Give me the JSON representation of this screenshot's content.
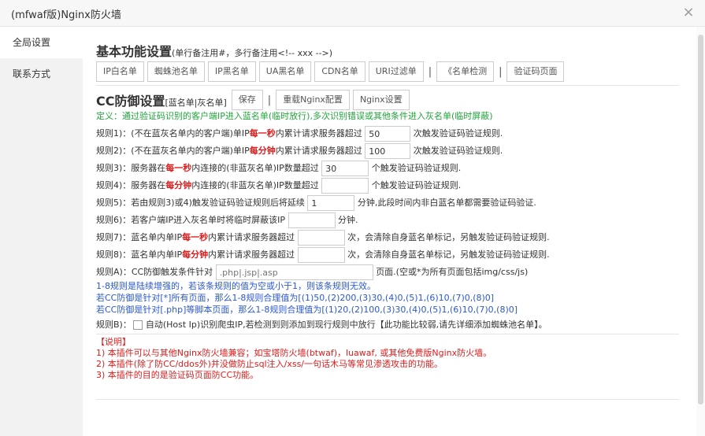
{
  "window": {
    "title": "(mfwaf版)Nginx防火墙"
  },
  "sidebar": {
    "items": [
      {
        "label": "全局设置"
      },
      {
        "label": "联系方式"
      }
    ]
  },
  "basic": {
    "title": "基本功能设置",
    "note": "(单行备注用#，多行备注用<!-- xxx -->)",
    "buttons": [
      "IP白名单",
      "蜘蛛池名单",
      "IP黑名单",
      "UA黑名单",
      "CDN名单",
      "URI过滤单"
    ],
    "sep": "|",
    "btn_detect": "《名单检测",
    "btn_captcha": "验证码页面"
  },
  "cc": {
    "title": "CC防御设置",
    "note": "[蓝名单|灰名单]",
    "btn_save": "保存",
    "btn_reload": "重载Nginx配置",
    "btn_nginx": "Nginx设置",
    "definition": "定义：通过验证码识别的客户端IP进入蓝名单(临时放行),多次识别错误或其他条件进入灰名单(临时屏蔽)"
  },
  "rules": {
    "r1": {
      "p1": "规则1)：(不在蓝灰名单内的客户端)单IP",
      "em": "每一秒",
      "p2": "内累计请求服务器超过",
      "value": "50",
      "p3": "次触发验证码验证规则."
    },
    "r2": {
      "p1": "规则2)：(不在蓝灰名单内的客户端)单IP",
      "em": "每分钟",
      "p2": "内累计请求服务器超过",
      "value": "100",
      "p3": "次触发验证码验证规则."
    },
    "r3": {
      "p1": "规则3)：服务器在",
      "em": "每一秒",
      "p2": "内连接的(非蓝灰名单)IP数量超过",
      "value": "30",
      "p3": "个触发验证码验证规则."
    },
    "r4": {
      "p1": "规则4)：服务器在",
      "em": "每分钟",
      "p2": "内连接的(非蓝灰名单)IP数量超过",
      "value": "",
      "p3": "个触发验证码验证规则."
    },
    "r5": {
      "p1": "规则5)：若由规则3)或4)触发验证码验证规则后将延续",
      "value": "1",
      "p2": "分钟,此段时间内非白蓝名单都需要验证码验证."
    },
    "r6": {
      "p1": "规则6)：若客户端IP进入灰名单时将临时屏蔽该IP",
      "value": "",
      "p2": "分钟."
    },
    "r7": {
      "p1": "规则7)：蓝名单内单IP",
      "em": "每一秒",
      "p2": "内累计请求服务器超过",
      "value": "",
      "p3": "次，会清除自身蓝名单标记，另触发验证码验证规则."
    },
    "r8": {
      "p1": "规则8)：蓝名单内单IP",
      "em": "每分钟",
      "p2": "内累计请求服务器超过",
      "value": "",
      "p3": "次，会清除自身蓝名单标记，另触发验证码验证规则."
    },
    "ra": {
      "p1": "规则A)：CC防御触发条件针对",
      "placeholder": ".php|.jsp|.asp",
      "p2": "页面.(空或*为所有页面包括img/css/js)"
    },
    "info1": "1-8规则是陆续增强的，若该条规则的值为空或小于1，则该条规则无效。",
    "info2": "若CC防御是针对[*]所有页面，那么1-8规则合理值为[(1)50,(2)200,(3)30,(4)0,(5)1,(6)10,(7)0,(8)0]",
    "info3": "若CC防御是针对[.php]等脚本页面，那么1-8规则合理值为[(1)20,(2)100,(3)30,(4)0,(5)1,(6)10,(7)0,(8)0]",
    "rb": {
      "p1": "规则B)：",
      "p2": "自动(Host Ip)识别爬虫IP,若检测到则添加到现行规则中放行【此功能比较弱,请先详细添加蜘蛛池名单】。"
    }
  },
  "notes": {
    "title": "【说明】",
    "items": [
      "1) 本插件可以与其他Nginx防火墙兼容；如宝塔防火墙(btwaf)，luawaf, 或其他免费版Nginx防火墙。",
      "2) 本插件(除了防CC/ddos外)并没做防止sql注入/xss/一句话木马等常见渗透攻击的功能。",
      "3) 本插件的目的是验证码页面防CC功能。"
    ]
  }
}
